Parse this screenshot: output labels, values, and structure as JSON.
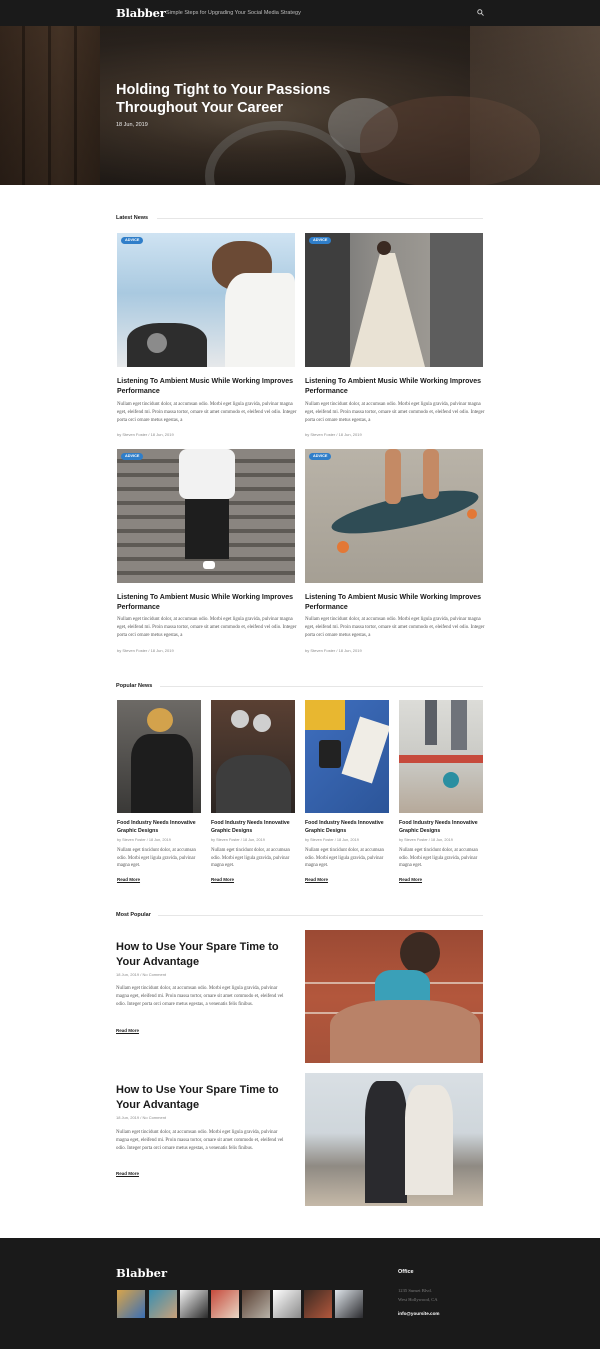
{
  "header": {
    "logo": "Blabber",
    "tagline": "Simple Steps for Upgrading Your Social Media Strategy",
    "search_icon": "search-icon"
  },
  "hero": {
    "title": "Holding Tight to Your Passions Throughout Your Career",
    "date": "18 Jun, 2019"
  },
  "latest_news": {
    "heading": "Latest News",
    "cards": [
      {
        "badge": "ADVICE",
        "title": "Listening To Ambient Music While Working Improves Performance",
        "excerpt": "Nullam eget tincidunt dolor, at accumsan odio. Morbi eget ligula gravida, pulvinar magna eget, eleifend mi. Proin massa tortor, ornare sit amet commodo et, eleifend vel odio. Integer porta orci ornare metus egestas, a",
        "meta": "by Steven Foster  /  18 Jun, 2019"
      },
      {
        "badge": "ADVICE",
        "title": "Listening To Ambient Music While Working Improves Performance",
        "excerpt": "Nullam eget tincidunt dolor, at accumsan odio. Morbi eget ligula gravida, pulvinar magna eget, eleifend mi. Proin massa tortor, ornare sit amet commodo et, eleifend vel odio. Integer porta orci ornare metus egestas, a",
        "meta": "by Steven Foster  /  18 Jun, 2019"
      },
      {
        "badge": "ADVICE",
        "title": "Listening To Ambient Music While Working Improves Performance",
        "excerpt": "Nullam eget tincidunt dolor, at accumsan odio. Morbi eget ligula gravida, pulvinar magna eget, eleifend mi. Proin massa tortor, ornare sit amet commodo et, eleifend vel odio. Integer porta orci ornare metus egestas, a",
        "meta": "by Steven Foster  /  18 Jun, 2019"
      },
      {
        "badge": "ADVICE",
        "title": "Listening To Ambient Music While Working Improves Performance",
        "excerpt": "Nullam eget tincidunt dolor, at accumsan odio. Morbi eget ligula gravida, pulvinar magna eget, eleifend mi. Proin massa tortor, ornare sit amet commodo et, eleifend vel odio. Integer porta orci ornare metus egestas, a",
        "meta": "by Steven Foster  /  18 Jun, 2019"
      }
    ]
  },
  "popular_news": {
    "heading": "Popular News",
    "items": [
      {
        "title": "Food Industry Needs Innovative Graphic Designs",
        "meta": "by Steven Foster  /  18 Jun, 2019",
        "excerpt": "Nullam eget tincidunt dolor, at accumsan odio. Morbi eget ligula gravida, pulvinar magna eget.",
        "read_more": "Read More"
      },
      {
        "title": "Food Industry Needs Innovative Graphic Designs",
        "meta": "by Steven Foster  /  18 Jun, 2019",
        "excerpt": "Nullam eget tincidunt dolor, at accumsan odio. Morbi eget ligula gravida, pulvinar magna eget.",
        "read_more": "Read More"
      },
      {
        "title": "Food Industry Needs Innovative Graphic Designs",
        "meta": "by Steven Foster  /  18 Jun, 2019",
        "excerpt": "Nullam eget tincidunt dolor, at accumsan odio. Morbi eget ligula gravida, pulvinar magna eget.",
        "read_more": "Read More"
      },
      {
        "title": "Food Industry Needs Innovative Graphic Designs",
        "meta": "by Steven Foster  /  18 Jun, 2019",
        "excerpt": "Nullam eget tincidunt dolor, at accumsan odio. Morbi eget ligula gravida, pulvinar magna eget.",
        "read_more": "Read More"
      }
    ]
  },
  "most_popular": {
    "heading": "Most Popular",
    "items": [
      {
        "title": "How to Use Your Spare Time to Your Advantage",
        "meta": "18 Jun, 2019  /  No Comment",
        "excerpt": "Nullam eget tincidunt dolor, at accumsan odio. Morbi eget ligula gravida, pulvinar magna eget, eleifend mi. Proin massa tortor, ornare sit amet commodo et, eleifend vel odio. Integer porta orci ornare metus egestas, a venenatis felis finibus.",
        "read_more": "Read More"
      },
      {
        "title": "How to Use Your Spare Time to Your Advantage",
        "meta": "18 Jun, 2019  /  No Comment",
        "excerpt": "Nullam eget tincidunt dolor, at accumsan odio. Morbi eget ligula gravida, pulvinar magna eget, eleifend mi. Proin massa tortor, ornare sit amet commodo et, eleifend vel odio. Integer porta orci ornare metus egestas, a venenatis felis finibus.",
        "read_more": "Read More"
      }
    ]
  },
  "footer": {
    "logo": "Blabber",
    "office_heading": "Office",
    "address_line1": "1235 Sunset Blvd.",
    "address_line2": "West Hollywood, CA",
    "email": "info@yoursite.com"
  },
  "colors": {
    "dark": "#1a1a1a",
    "badge_blue": "#2f7ec9",
    "body_text": "#555555"
  }
}
